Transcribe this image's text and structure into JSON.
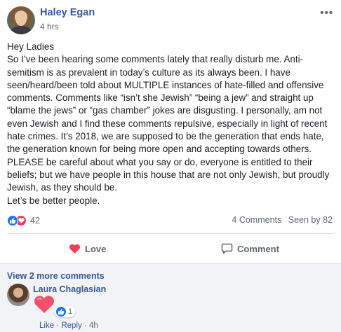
{
  "post": {
    "author": "Haley Egan",
    "time": "4 hrs",
    "more_icon": "more-horizontal-icon",
    "body": [
      "Hey Ladies",
      "So I’ve been hearing some comments lately that really disturb me. Anti-semitism is as prevalent in today’s culture as its always been. I have seen/heard/been told about MULTIPLE instances of hate-filled and offensive comments. Comments like “isn’t she Jewish” “being a jew” and straight up “blame the jews” or “gas chamber” jokes are disgusting. I personally, am not even Jewish and I find these comments repulsive, especially in light of recent hate crimes. It’s 2018, we are supposed to be the generation that ends hate, the generation known for being more open and accepting towards others. PLEASE be careful about what you say or do, everyone is entitled to their beliefs; but we have people in this house that are not only Jewish, but proudly Jewish, as they should be.",
      "Let’s be better people."
    ]
  },
  "reactions": {
    "count": "42",
    "comments": "4 Comments",
    "seen": "Seen by 82",
    "like_color": "#1877f2",
    "love_color": "#f33e58"
  },
  "actions": {
    "love_label": "Love",
    "comment_label": "Comment"
  },
  "comments": {
    "view_more": "View 2 more comments",
    "items": [
      {
        "author": "Laura Chaglasian",
        "sticker": "heart-sticker",
        "reaction_count": "1",
        "like_label": "Like",
        "reply_label": "Reply",
        "time": "4h"
      }
    ]
  },
  "colors": {
    "link": "#385898",
    "text": "#1c1e21",
    "muted": "#606770",
    "love_active": "#e0245e"
  }
}
